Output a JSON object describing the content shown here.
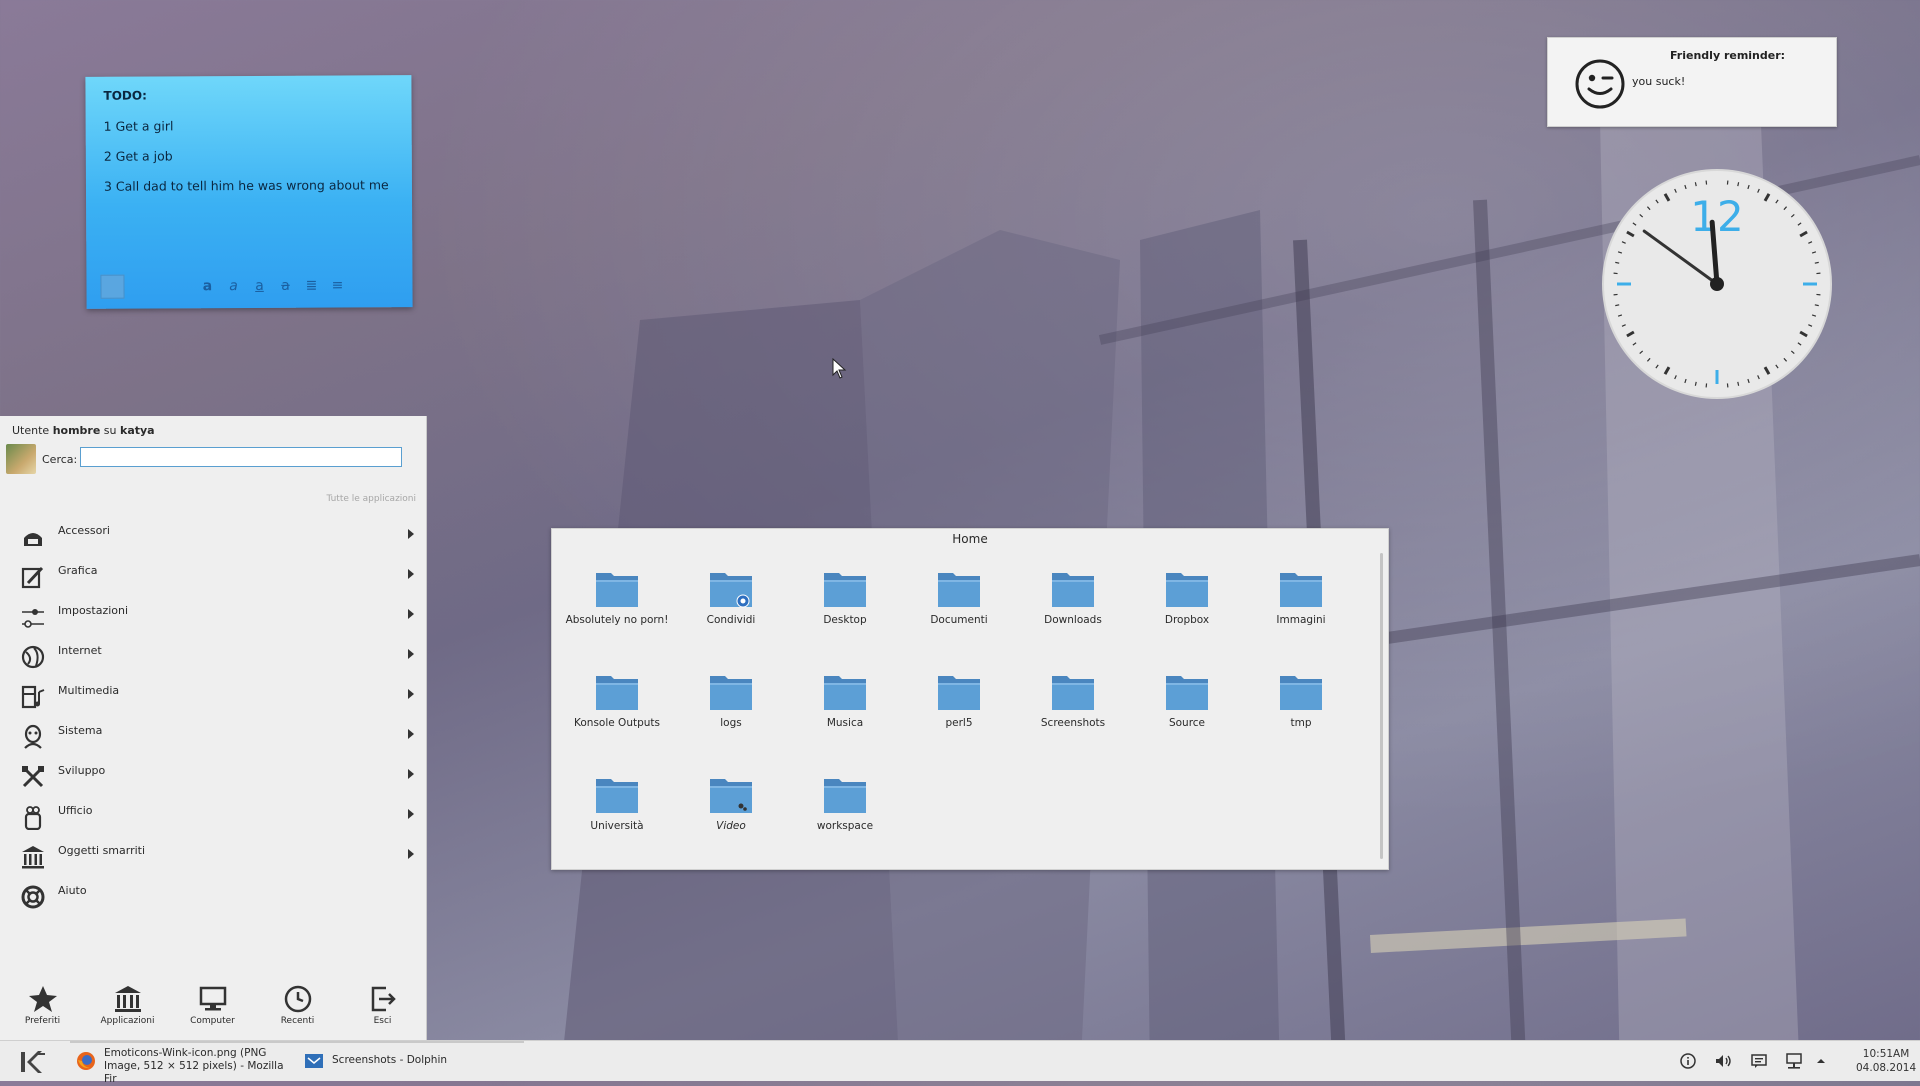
{
  "sticky_note": {
    "title": "TODO:",
    "lines": [
      "1 Get a girl",
      "2 Get a job",
      "3 Call dad to tell him he was wrong about me"
    ]
  },
  "reminder": {
    "title": "Friendly reminder:",
    "text": "you suck!"
  },
  "clock": {
    "twelve": "12",
    "hour": 11,
    "minute": 51
  },
  "menu": {
    "user_prefix": "Utente ",
    "user_name": "hombre",
    "user_mid": " su ",
    "host": "katya",
    "search_label": "Cerca:",
    "search_value": "",
    "all_apps": "Tutte le applicazioni",
    "categories": [
      {
        "label": "Accessori",
        "icon": "accessories-icon",
        "submenu": true
      },
      {
        "label": "Grafica",
        "icon": "graphics-icon",
        "submenu": true
      },
      {
        "label": "Impostazioni",
        "icon": "settings-icon",
        "submenu": true
      },
      {
        "label": "Internet",
        "icon": "internet-icon",
        "submenu": true
      },
      {
        "label": "Multimedia",
        "icon": "multimedia-icon",
        "submenu": true
      },
      {
        "label": "Sistema",
        "icon": "system-icon",
        "submenu": true
      },
      {
        "label": "Sviluppo",
        "icon": "development-icon",
        "submenu": true
      },
      {
        "label": "Ufficio",
        "icon": "office-icon",
        "submenu": true
      },
      {
        "label": "Oggetti smarriti",
        "icon": "lost-found-icon",
        "submenu": true
      },
      {
        "label": "Aiuto",
        "icon": "help-icon",
        "submenu": false
      }
    ],
    "tabs": [
      {
        "label": "Preferiti",
        "icon": "star-icon"
      },
      {
        "label": "Applicazioni",
        "icon": "applications-icon"
      },
      {
        "label": "Computer",
        "icon": "computer-icon"
      },
      {
        "label": "Recenti",
        "icon": "clock-icon"
      },
      {
        "label": "Esci",
        "icon": "logout-icon"
      }
    ]
  },
  "folderview": {
    "title": "Home",
    "folders": [
      {
        "label": "Absolutely no porn!",
        "badge": ""
      },
      {
        "label": "Condividi",
        "badge": "share"
      },
      {
        "label": "Desktop",
        "badge": ""
      },
      {
        "label": "Documenti",
        "badge": ""
      },
      {
        "label": "Downloads",
        "badge": ""
      },
      {
        "label": "Dropbox",
        "badge": ""
      },
      {
        "label": "Immagini",
        "badge": ""
      },
      {
        "label": "Konsole Outputs",
        "badge": ""
      },
      {
        "label": "logs",
        "badge": ""
      },
      {
        "label": "Musica",
        "badge": ""
      },
      {
        "label": "perl5",
        "badge": ""
      },
      {
        "label": "Screenshots",
        "badge": ""
      },
      {
        "label": "Source",
        "badge": ""
      },
      {
        "label": "tmp",
        "badge": ""
      },
      {
        "label": "Università",
        "badge": ""
      },
      {
        "label": "Video",
        "badge": "link",
        "italic": true
      },
      {
        "label": "workspace",
        "badge": ""
      }
    ]
  },
  "taskbar": {
    "tasks": [
      {
        "label": "Emoticons-Wink-icon.png (PNG Image, 512 × 512 pixels) - Mozilla Fir",
        "icon": "firefox-icon"
      },
      {
        "label": "Screenshots - Dolphin",
        "icon": "dolphin-icon"
      }
    ],
    "time": "10:51AM",
    "date": "04.08.2014"
  },
  "colors": {
    "accent": "#3daee9",
    "note_top": "#6fd7fa",
    "note_bottom": "#2f9ef0",
    "folder": "#5c9fd6"
  }
}
